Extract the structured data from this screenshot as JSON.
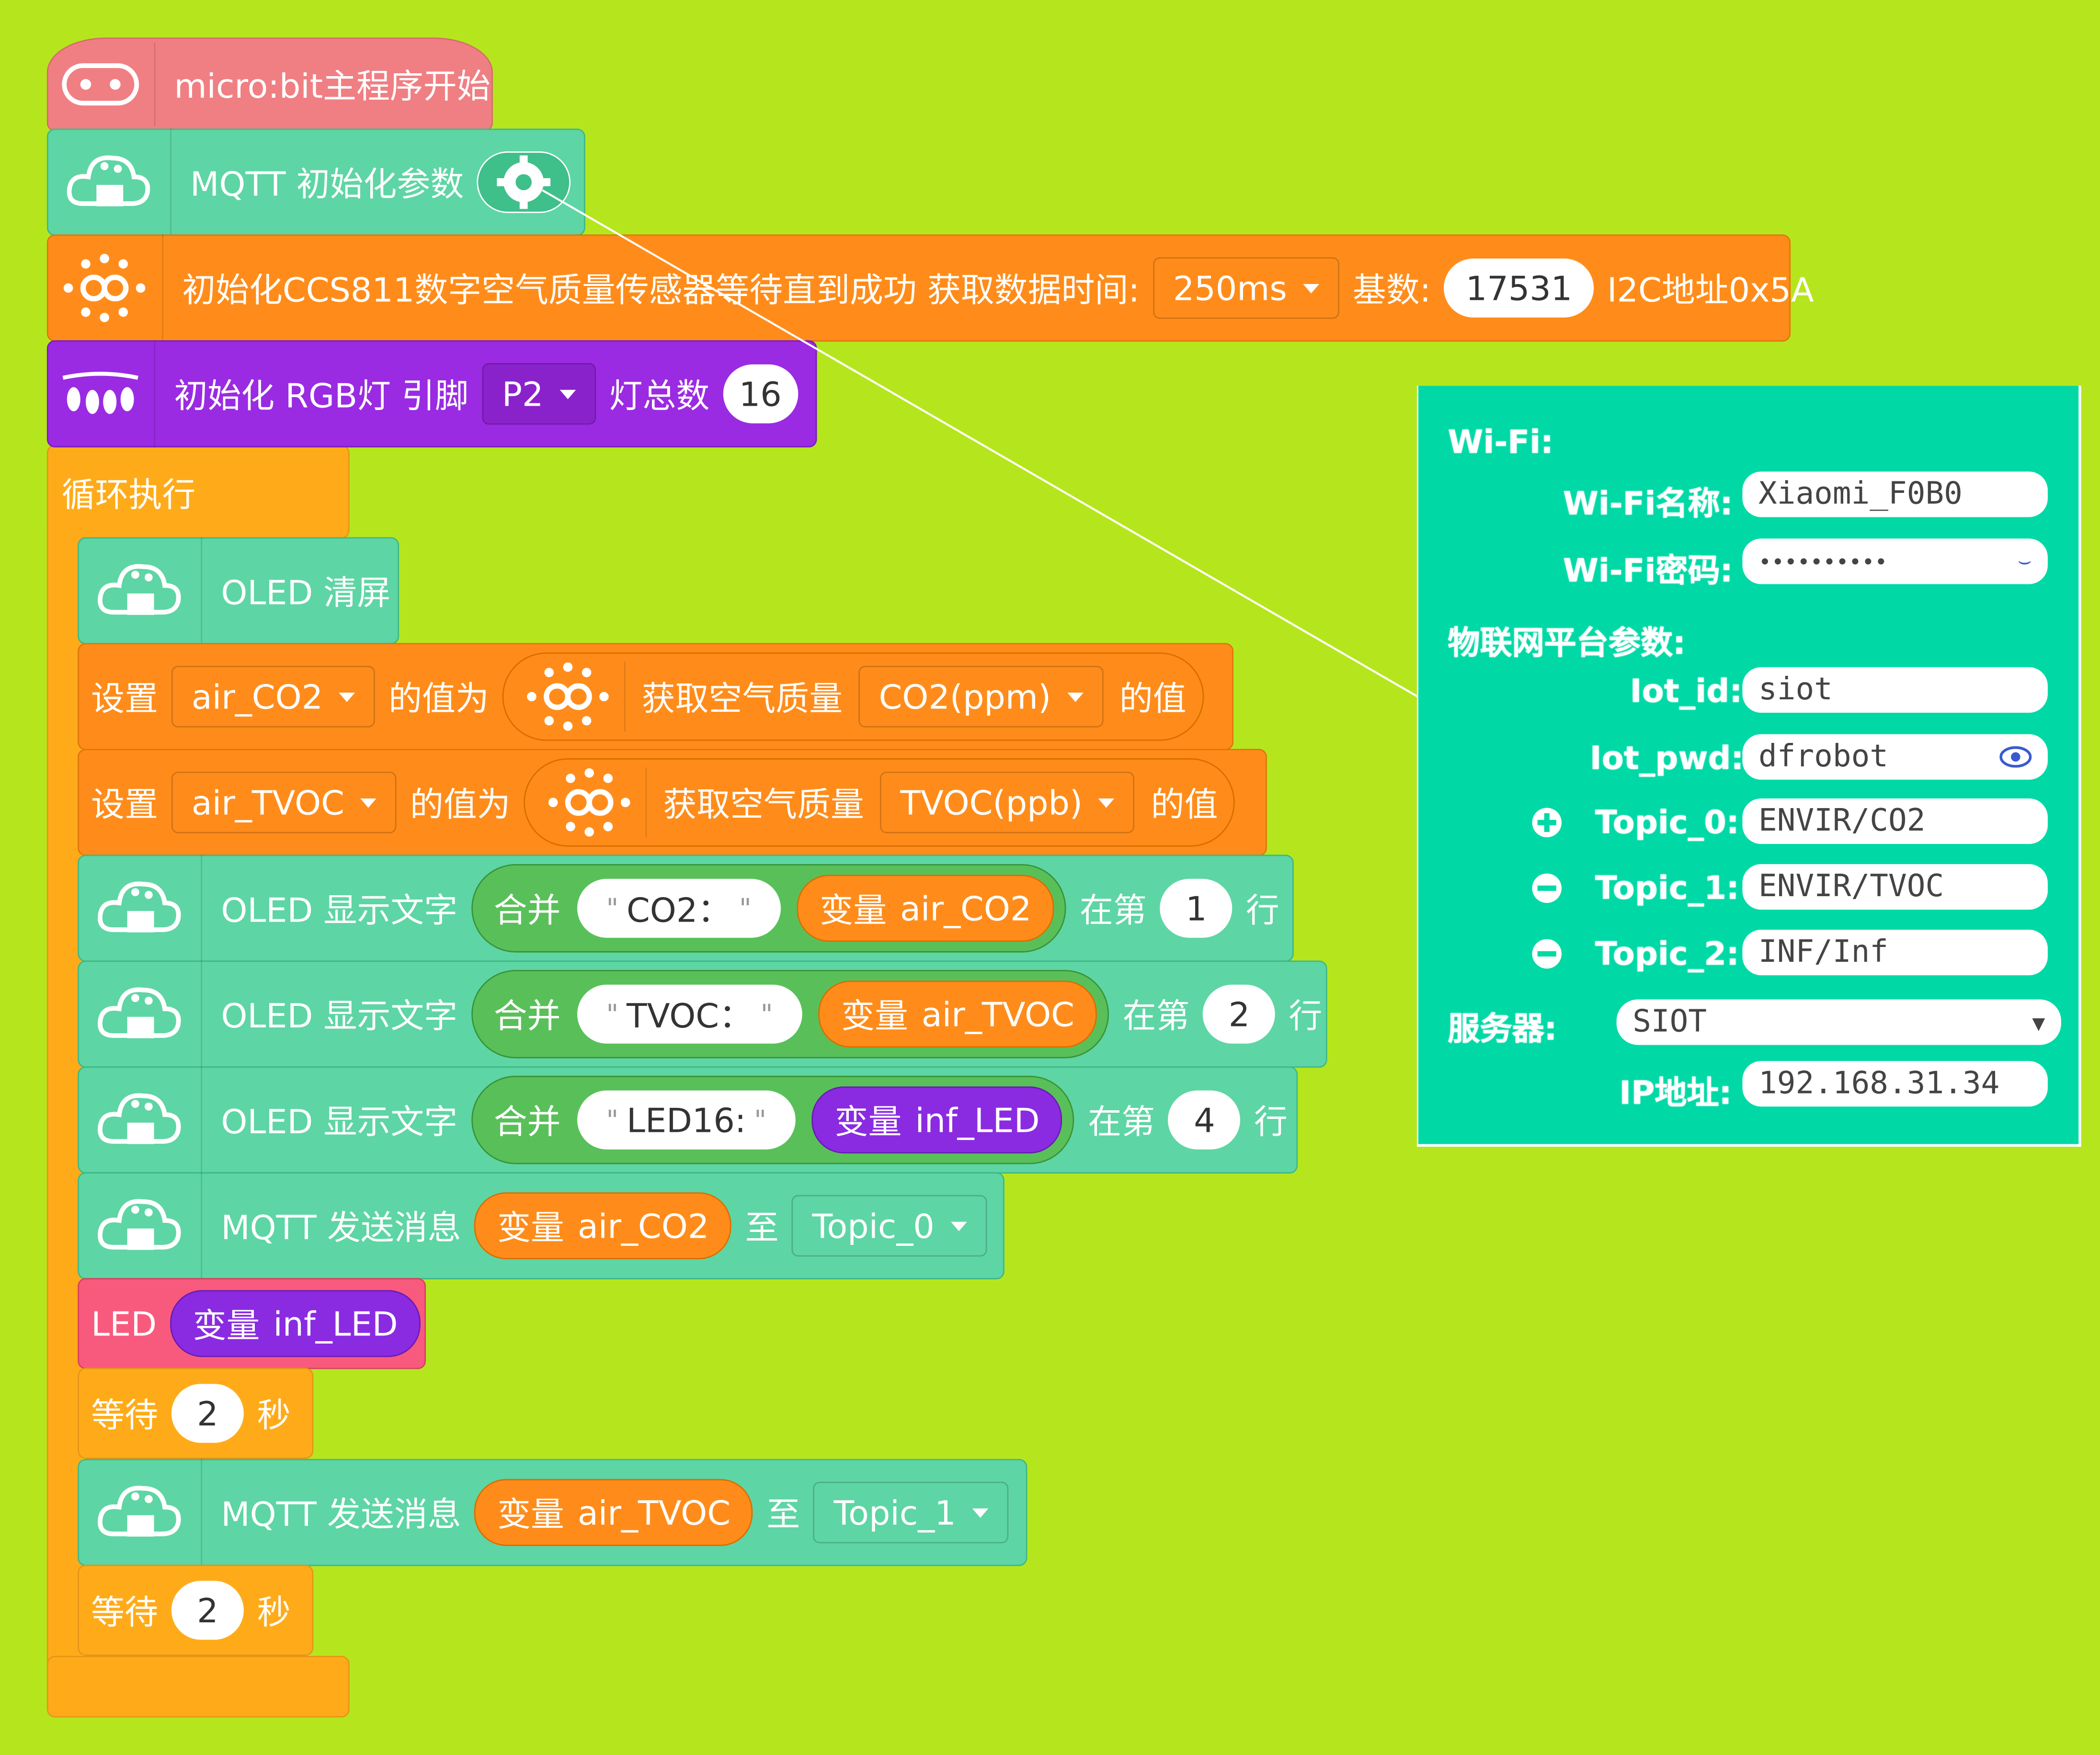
{
  "main_block": {
    "label": "micro:bit主程序开始"
  },
  "mqtt_init": {
    "label": "MQTT 初始化参数"
  },
  "ccs811": {
    "label": "初始化CCS811数字空气质量传感器等待直到成功 获取数据时间:",
    "time_value": "250ms",
    "base_label": "基数:",
    "base_value": "17531",
    "addr_label": "I2C地址0x5A"
  },
  "rgb": {
    "label": "初始化 RGB灯 引脚",
    "pin_value": "P2",
    "count_label": "灯总数",
    "count_value": "16"
  },
  "loop": {
    "label": "循环执行"
  },
  "oled_clear": {
    "label": "OLED 清屏"
  },
  "set_co2": {
    "set": "设置",
    "var": "air_CO2",
    "value_as": "的值为",
    "get": "获取空气质量",
    "option": "CO2(ppm)",
    "of": "的值"
  },
  "set_tvoc": {
    "set": "设置",
    "var": "air_TVOC",
    "value_as": "的值为",
    "get": "获取空气质量",
    "option": "TVOC(ppb)",
    "of": "的值"
  },
  "oled_show": [
    {
      "label": "OLED 显示文字",
      "join": "合并",
      "text": "CO2：",
      "var_label": "变量",
      "var": "air_CO2",
      "at": "在第",
      "line": "1",
      "row": "行"
    },
    {
      "label": "OLED 显示文字",
      "join": "合并",
      "text": "TVOC：",
      "var_label": "变量",
      "var": "air_TVOC",
      "at": "在第",
      "line": "2",
      "row": "行"
    },
    {
      "label": "OLED 显示文字",
      "join": "合并",
      "text": "LED16:",
      "var_label": "变量",
      "var": "inf_LED",
      "at": "在第",
      "line": "4",
      "row": "行"
    }
  ],
  "mqtt_send_1": {
    "label": "MQTT 发送消息",
    "var_label": "变量",
    "var": "air_CO2",
    "to": "至",
    "topic": "Topic_0"
  },
  "led": {
    "label": "LED",
    "var_label": "变量",
    "var": "inf_LED"
  },
  "wait_1": {
    "label": "等待",
    "value": "2",
    "unit": "秒"
  },
  "mqtt_send_2": {
    "label": "MQTT 发送消息",
    "var_label": "变量",
    "var": "air_TVOC",
    "to": "至",
    "topic": "Topic_1"
  },
  "wait_2": {
    "label": "等待",
    "value": "2",
    "unit": "秒"
  },
  "settings_panel": {
    "wifi_heading": "Wi-Fi:",
    "wifi_name_label": "Wi-Fi名称:",
    "wifi_name_value": "Xiaomi_F0B0",
    "wifi_pwd_label": "Wi-Fi密码:",
    "wifi_pwd_value": "••••••••••",
    "iot_heading": "物联网平台参数:",
    "iot_id_label": "Iot_id:",
    "iot_id_value": "siot",
    "iot_pwd_label": "Iot_pwd:",
    "iot_pwd_value": "dfrobot",
    "topic0_label": "Topic_0:",
    "topic0_value": "ENVIR/CO2",
    "topic1_label": "Topic_1:",
    "topic1_value": "ENVIR/TVOC",
    "topic2_label": "Topic_2:",
    "topic2_value": "INF/Inf",
    "server_label": "服务器:",
    "server_value": "SIOT",
    "ip_label": "IP地址:",
    "ip_value": "192.168.31.34"
  },
  "colors": {
    "background": "#b5e61d",
    "start": "#f07f83",
    "iot": "#5ed5a4",
    "sensor": "#ff8c1a",
    "rgb": "#9a2be2",
    "control": "#ffab19",
    "var": "#ff8c1a",
    "led": "#f85a7d",
    "join": "#59c059",
    "panel": "#00d9a6"
  }
}
